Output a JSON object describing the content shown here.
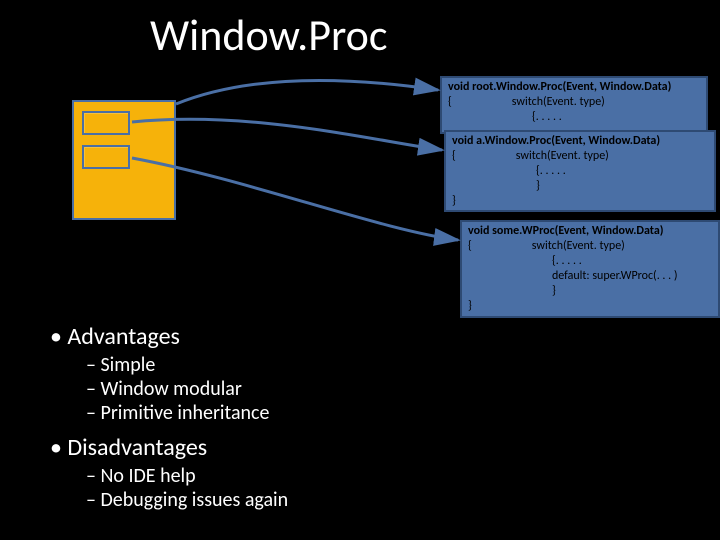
{
  "title": "Window.Proc",
  "code": {
    "box1": {
      "sig": "void root.Window.Proc(Event, Window.Data)",
      "l1": "{",
      "l2": "switch(Event. type)",
      "l3": "{. . . . ."
    },
    "box2": {
      "sig": "void a.Window.Proc(Event, Window.Data)",
      "l1": "{",
      "l2": "switch(Event. type)",
      "l3": "{. . . . .",
      "l4": "}",
      "l5": "}"
    },
    "box3": {
      "sig": "void some.WProc(Event, Window.Data)",
      "l1": "{",
      "l2": "switch(Event. type)",
      "l3": "{. . . . .",
      "l4": "default: super.WProc(. . . )",
      "l5": "}",
      "l6": "}"
    }
  },
  "adv_heading": "Advantages",
  "adv": {
    "a1": "Simple",
    "a2": "Window modular",
    "a3": "Primitive inheritance"
  },
  "dis_heading": "Disadvantages",
  "dis": {
    "d1": "No IDE help",
    "d2": "Debugging issues again"
  }
}
